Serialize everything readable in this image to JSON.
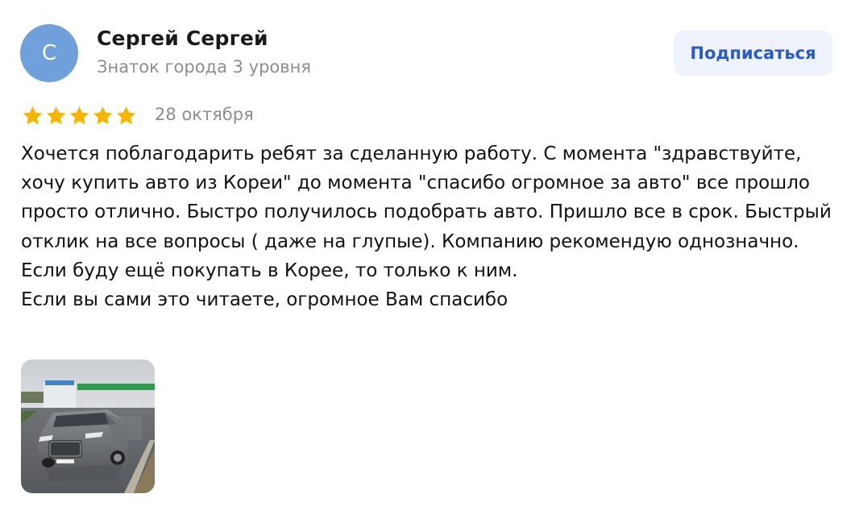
{
  "author": {
    "initial": "С",
    "name": "Сергей Сергей",
    "level": "Знаток города 3 уровня"
  },
  "subscribe": {
    "label": "Подписаться"
  },
  "review": {
    "rating": 5,
    "date": "28 октября",
    "text_main": "Хочется поблагодарить ребят за сделанную работу. С момента \"здравствуйте, хочу купить авто из Кореи\" до момента \"спасибо огромное за авто\" все прошло просто отлично. Быстро получилось подобрать авто. Пришло все в срок. Быстрый отклик на все вопросы ( даже на глупые). Компанию рекомендую однозначно. Если буду ещё покупать в Корее, то только к ним.",
    "text_end": "Если вы сами это читаете, огромное Вам спасибо"
  },
  "colors": {
    "avatar_bg": "#6fa0dc",
    "star": "#f7b500",
    "subscribe_text": "#2b5bc8",
    "subscribe_bg": "#eef3fb"
  },
  "icons": {
    "star": "star-icon"
  }
}
